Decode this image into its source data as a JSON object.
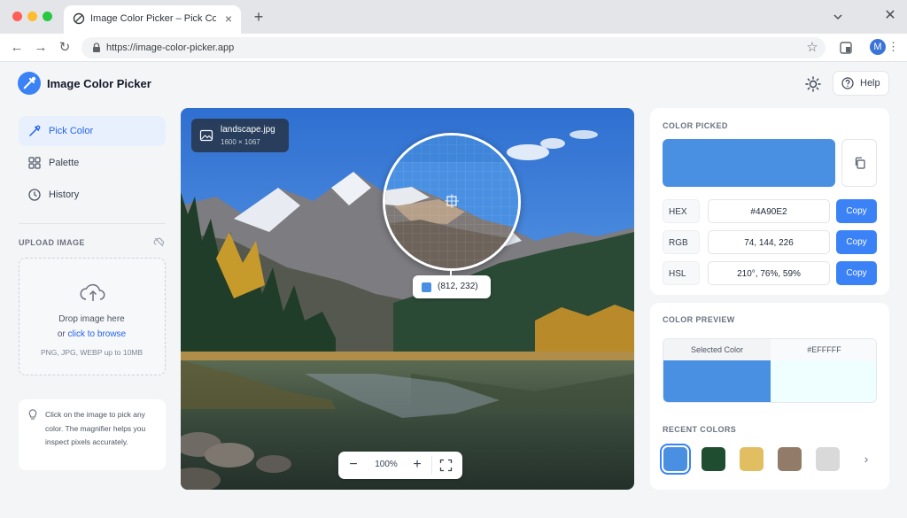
{
  "browser": {
    "tab_title": "Image Color Picker – Pick Color",
    "url": "https://image-color-picker.app",
    "profile_initial": "M"
  },
  "app": {
    "title": "Image Color Picker",
    "help_label": "Help",
    "accent_color": "#3B82F6"
  },
  "sidebar": {
    "items": [
      {
        "label": "Pick Color",
        "icon": "eyedropper-icon",
        "active": true
      },
      {
        "label": "Palette",
        "icon": "grid-icon",
        "active": false
      },
      {
        "label": "History",
        "icon": "clock-icon",
        "active": false
      }
    ],
    "upload_title": "UPLOAD IMAGE",
    "drop_line1": "Drop image here",
    "drop_or": "or",
    "drop_link": "click to browse",
    "drop_formats": "PNG, JPG, WEBP up to 10MB",
    "tip": "Click on the image to pick any color. The magnifier helps you inspect pixels accurately."
  },
  "canvas": {
    "file_name": "landscape.jpg",
    "file_dims": "1600 × 1067",
    "coords": "(812, 232)",
    "zoom": "100%"
  },
  "picked": {
    "title": "COLOR PICKED",
    "color": "#4A90E2",
    "rows": [
      {
        "label": "HEX",
        "value": "#4A90E2",
        "copy": "Copy"
      },
      {
        "label": "RGB",
        "value": "74, 144, 226",
        "copy": "Copy"
      },
      {
        "label": "HSL",
        "value": "210°, 76%, 59%",
        "copy": "Copy"
      }
    ]
  },
  "preview": {
    "title": "COLOR PREVIEW",
    "selected_label": "Selected Color",
    "reference_label": "#EFFFFF",
    "reference_color": "#EFFFFF"
  },
  "recent": {
    "title": "RECENT COLORS",
    "colors": [
      "#4A90E2",
      "#1F4D2F",
      "#E2BE63",
      "#937B69",
      "#D9D9D9"
    ],
    "selected_index": 0
  }
}
